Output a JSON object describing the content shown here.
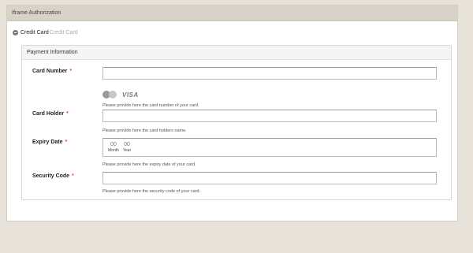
{
  "panel": {
    "title": "Iframe Authorization"
  },
  "method": {
    "name": "Credit Card",
    "subtitle": "Credit Card"
  },
  "fieldset": {
    "title": "Payment Information"
  },
  "fields": {
    "card_number": {
      "label": "Card Number",
      "required_mark": "*",
      "value": "",
      "help": "Please provide here the card number of your card."
    },
    "logos": {
      "mastercard_text": "MasterCard",
      "visa_text": "VISA"
    },
    "card_holder": {
      "label": "Card Holder",
      "required_mark": "*",
      "value": "",
      "help": "Please provide here the card holders name."
    },
    "expiry": {
      "label": "Expiry Date",
      "required_mark": "*",
      "month_value": "00",
      "month_label": "Month",
      "year_value": "00",
      "year_label": "Year",
      "help": "Please provide here the expiry date of your card."
    },
    "security_code": {
      "label": "Security Code",
      "required_mark": "*",
      "value": "",
      "help": "Please provide here the security code of your card."
    }
  },
  "colors": {
    "page_bg": "#e8e3da",
    "header_bg": "#d9d3c7",
    "required": "#d9534f"
  }
}
